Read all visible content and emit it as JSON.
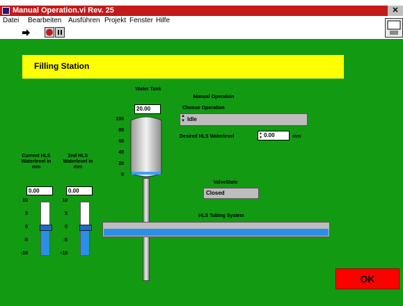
{
  "window": {
    "title": "Manual Operation.vi Rev. 25",
    "close_glyph": "✕"
  },
  "menu": [
    "Datei",
    "Bearbeiten",
    "Ausführen",
    "Projekt",
    "Fenster",
    "Hilfe"
  ],
  "toolbar": {
    "run_icon": "arrow-run-icon",
    "abort_icon": "abort-icon",
    "pause_icon": "pause-icon"
  },
  "panel": {
    "header": "Filling Station",
    "tank": {
      "label": "Water Tank",
      "value": "20.00",
      "scale": [
        "100",
        "80",
        "60",
        "40",
        "20",
        "0"
      ],
      "level": 20
    },
    "manual": {
      "label": "Manual Operation",
      "choose_label": "Choose Operation",
      "operation": "Idle",
      "desired_label": "Desired HLS Waterlevel",
      "desired_value": "0.00",
      "unit": "mm"
    },
    "valve": {
      "label": "ValveState",
      "value": "Closed"
    },
    "tubing": {
      "label": "HLS Tubing System"
    },
    "slider1": {
      "label": "Current HLS Waterlevel in mm",
      "value": "0.00",
      "scale": [
        "10",
        "5",
        "0",
        "-5",
        "-10"
      ],
      "level": 0
    },
    "slider2": {
      "label": "2nd HLS Waterlevel in mm",
      "value": "0.00",
      "scale": [
        "10",
        "5",
        "0",
        "-5",
        "-10"
      ],
      "level": 0
    },
    "ok": "OK"
  }
}
